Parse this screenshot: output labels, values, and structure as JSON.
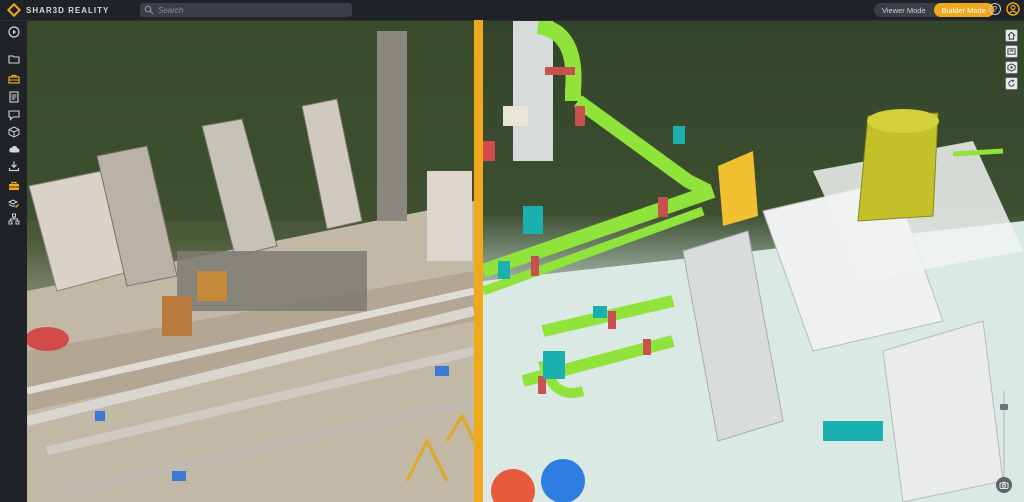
{
  "app": {
    "brand": "SHAR3D REALITY"
  },
  "search": {
    "placeholder": "Search"
  },
  "modes": [
    {
      "label": "Viewer Mode",
      "active": false
    },
    {
      "label": "Builder Mode",
      "active": true
    }
  ],
  "help": {
    "label": "?"
  },
  "colors": {
    "accent": "#f0a81d",
    "topbar": "#1f2327",
    "sidebar": "#1f2327",
    "pipe_green": "#8fe33a",
    "pipe_teal": "#1ab0b0",
    "pipe_red": "#c85050"
  },
  "sidebar": {
    "items": [
      {
        "name": "play-icon"
      },
      {
        "name": "folder-icon"
      },
      {
        "name": "toolbox-icon"
      },
      {
        "name": "document-icon"
      },
      {
        "name": "comment-icon"
      },
      {
        "name": "cube-icon"
      },
      {
        "name": "cloud-icon"
      },
      {
        "name": "download-icon"
      },
      {
        "name": "builder-toolbox-icon"
      },
      {
        "name": "layers-edit-icon"
      },
      {
        "name": "hierarchy-icon"
      }
    ]
  },
  "viewport_tools": [
    {
      "name": "home-view-icon"
    },
    {
      "name": "model-view-icon"
    },
    {
      "name": "measure-icon"
    },
    {
      "name": "rotate-view-icon"
    }
  ]
}
